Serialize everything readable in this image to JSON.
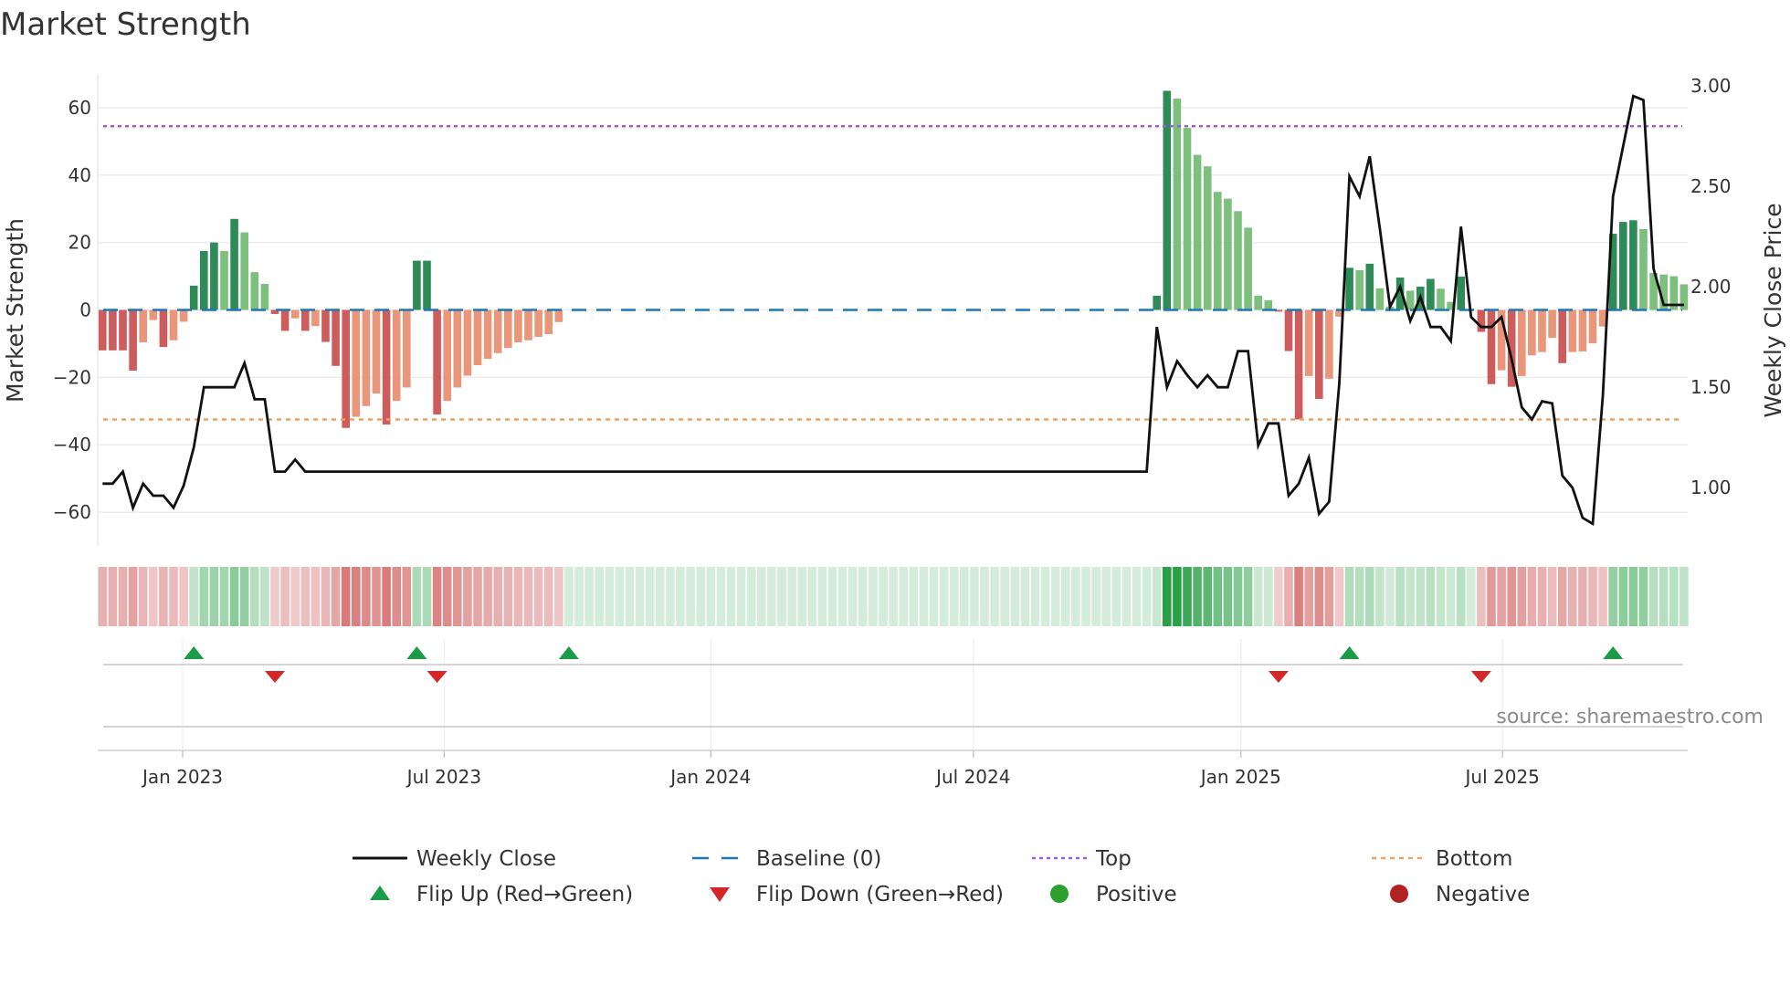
{
  "title": "Market Strength",
  "source": "source: sharemaestro.com",
  "colors": {
    "pos_dark": "#2e8b57",
    "pos_light": "#7dbf7d",
    "neg_dark": "#cd5c5c",
    "neg_light": "#e9967a",
    "close": "#111111",
    "baseline": "#1f77b4",
    "top": "#9b5de5",
    "bottom": "#f0a35e",
    "flip_up": "#1a9c47",
    "flip_down": "#d62728",
    "positive": "#2ca02c",
    "negative": "#b22222"
  },
  "chart_data": {
    "type": "bar",
    "title": "Market Strength",
    "ylabel": "Market Strength",
    "y2label": "Weekly Close Price",
    "ylim": [
      -70,
      70
    ],
    "y2lim": [
      0.71,
      3.06
    ],
    "yticks": [
      60,
      40,
      20,
      0,
      -20,
      -40,
      -60
    ],
    "ytick_labels": [
      "60",
      "40",
      "20",
      "0",
      "−20",
      "−40",
      "−60"
    ],
    "y2ticks": [
      3.0,
      2.5,
      2.0,
      1.5,
      1.0
    ],
    "y2tick_labels": [
      "3.00",
      "2.50",
      "2.00",
      "1.50",
      "1.00"
    ],
    "xticks": [
      7.9,
      33.7,
      60,
      85.9,
      112.3,
      138.1
    ],
    "xtick_labels": [
      "Jan 2023",
      "Jul 2023",
      "Jan 2024",
      "Jul 2024",
      "Jan 2025",
      "Jul 2025"
    ],
    "top_level": 54.5,
    "bottom_level": -32.5,
    "baseline": 0,
    "strength": [
      -12,
      -12,
      -12,
      -18,
      -9.6,
      -3,
      -11,
      -9,
      -3.5,
      7.2,
      17.5,
      20,
      17.5,
      27,
      23,
      11.2,
      7.7,
      -1.2,
      -6.2,
      -2.5,
      -6.2,
      -4.8,
      -9.5,
      -16.6,
      -35,
      -31.7,
      -28.5,
      -24.8,
      -34,
      -27,
      -23,
      14.6,
      14.6,
      -31,
      -27,
      -23,
      -19.5,
      -16.4,
      -14.5,
      -12.8,
      -11.3,
      -9.6,
      -9,
      -8,
      -7.2,
      -3.6,
      0,
      0,
      0,
      0,
      0,
      0,
      0,
      0,
      0,
      0,
      0,
      0,
      0,
      0,
      0,
      0,
      0,
      0,
      0,
      0,
      0,
      0,
      0,
      0,
      0,
      0,
      0,
      0,
      0,
      0,
      0,
      0,
      0,
      0,
      0,
      0,
      0,
      0,
      0,
      0,
      0,
      0,
      0,
      0,
      0,
      0,
      0,
      0,
      0,
      0,
      0,
      0,
      0,
      0,
      0,
      0,
      0,
      0,
      4.2,
      65,
      62.7,
      54,
      46,
      42.6,
      35,
      33,
      29.3,
      24.4,
      4.2,
      2.9,
      -0.5,
      -12.2,
      -32.5,
      -19.6,
      -26.4,
      -20.4,
      -2,
      12.5,
      11.8,
      13.7,
      6.4,
      1,
      9.6,
      5.7,
      6.9,
      9.2,
      6.3,
      2.4,
      9.9,
      0,
      -6.5,
      -22,
      -17.9,
      -22.8,
      -19.6,
      -13.5,
      -12.5,
      -8.3,
      -15.8,
      -12.5,
      -12.3,
      -9.9,
      -4.9,
      22.6,
      26.1,
      26.6,
      24,
      11,
      10.5,
      10,
      7.6
    ],
    "strong": [
      1,
      1,
      1,
      1,
      0,
      0,
      1,
      0,
      0,
      1,
      1,
      1,
      0,
      1,
      0,
      0,
      0,
      1,
      1,
      0,
      1,
      0,
      1,
      1,
      1,
      0,
      0,
      0,
      1,
      0,
      0,
      1,
      1,
      1,
      0,
      0,
      0,
      0,
      0,
      0,
      0,
      0,
      0,
      0,
      0,
      0,
      0,
      0,
      0,
      0,
      0,
      0,
      0,
      0,
      0,
      0,
      0,
      0,
      0,
      0,
      0,
      0,
      0,
      0,
      0,
      0,
      0,
      0,
      0,
      0,
      0,
      0,
      0,
      0,
      0,
      0,
      0,
      0,
      0,
      0,
      0,
      0,
      0,
      0,
      0,
      0,
      0,
      0,
      0,
      0,
      0,
      0,
      0,
      0,
      0,
      0,
      0,
      0,
      0,
      0,
      0,
      0,
      0,
      0,
      1,
      1,
      0,
      0,
      0,
      0,
      0,
      0,
      0,
      0,
      0,
      0,
      1,
      1,
      1,
      0,
      1,
      0,
      0,
      1,
      0,
      1,
      0,
      0,
      1,
      0,
      1,
      1,
      0,
      0,
      1,
      0,
      1,
      1,
      0,
      1,
      0,
      0,
      0,
      0,
      1,
      0,
      0,
      0,
      0,
      1,
      1,
      1,
      0,
      0,
      0,
      0,
      0
    ],
    "close": [
      1.02,
      1.02,
      1.08,
      0.9,
      1.02,
      0.96,
      0.96,
      0.9,
      1.01,
      1.2,
      1.5,
      1.5,
      1.5,
      1.5,
      1.62,
      1.44,
      1.44,
      1.08,
      1.08,
      1.14,
      1.08,
      1.08,
      1.08,
      1.08,
      1.08,
      1.08,
      1.08,
      1.08,
      1.08,
      1.08,
      1.08,
      1.08,
      1.08,
      1.08,
      1.08,
      1.08,
      1.08,
      1.08,
      1.08,
      1.08,
      1.08,
      1.08,
      1.08,
      1.08,
      1.08,
      1.08,
      1.08,
      1.08,
      1.08,
      1.08,
      1.08,
      1.08,
      1.08,
      1.08,
      1.08,
      1.08,
      1.08,
      1.08,
      1.08,
      1.08,
      1.08,
      1.08,
      1.08,
      1.08,
      1.08,
      1.08,
      1.08,
      1.08,
      1.08,
      1.08,
      1.08,
      1.08,
      1.08,
      1.08,
      1.08,
      1.08,
      1.08,
      1.08,
      1.08,
      1.08,
      1.08,
      1.08,
      1.08,
      1.08,
      1.08,
      1.08,
      1.08,
      1.08,
      1.08,
      1.08,
      1.08,
      1.08,
      1.08,
      1.08,
      1.08,
      1.08,
      1.08,
      1.08,
      1.08,
      1.08,
      1.08,
      1.08,
      1.08,
      1.08,
      1.8,
      1.5,
      1.63,
      1.56,
      1.5,
      1.56,
      1.5,
      1.5,
      1.68,
      1.68,
      1.21,
      1.32,
      1.32,
      0.96,
      1.02,
      1.15,
      0.87,
      0.93,
      1.52,
      2.55,
      2.45,
      2.65,
      2.29,
      1.9,
      2.0,
      1.83,
      1.95,
      1.8,
      1.8,
      1.73,
      2.3,
      1.85,
      1.8,
      1.8,
      1.85,
      1.64,
      1.4,
      1.34,
      1.43,
      1.42,
      1.06,
      1.0,
      0.85,
      0.82,
      1.46,
      2.45,
      2.7,
      2.95,
      2.93,
      2.09,
      1.91,
      1.91,
      1.91
    ],
    "flip_up_weeks": [
      9,
      31,
      46,
      123,
      149
    ],
    "flip_down_weeks": [
      17,
      33,
      116,
      136
    ],
    "legend": {
      "placement": "bottom",
      "items": [
        "Weekly Close",
        "Baseline (0)",
        "Top",
        "Bottom",
        "Flip Up (Red→Green)",
        "Flip Down (Green→Red)",
        "Positive",
        "Negative"
      ]
    }
  }
}
